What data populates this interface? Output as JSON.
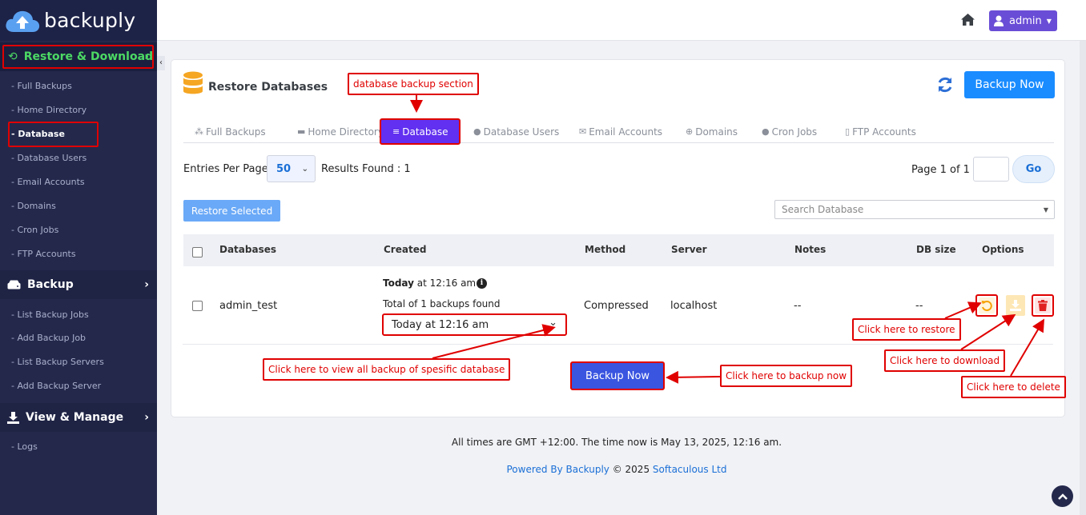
{
  "brand": {
    "name": "backuply"
  },
  "sidebar": {
    "sections": [
      {
        "label": "Restore & Download",
        "items": [
          "- Full Backups",
          "- Home Directory",
          "- Database",
          "- Database Users",
          "- Email Accounts",
          "- Domains",
          "- Cron Jobs",
          "- FTP Accounts"
        ]
      },
      {
        "label": "Backup",
        "items": [
          "- List Backup Jobs",
          "- Add Backup Job",
          "- List Backup Servers",
          "- Add Backup Server"
        ]
      },
      {
        "label": "View & Manage",
        "items": [
          "- Logs"
        ]
      }
    ],
    "current_item": "- Database",
    "collapse_glyph": "‹"
  },
  "topbar": {
    "user": "admin"
  },
  "card": {
    "title": "Restore Databases",
    "backup_now": "Backup Now",
    "tabs": [
      "Full Backups",
      "Home Directory",
      "Database",
      "Database Users",
      "Email Accounts",
      "Domains",
      "Cron Jobs",
      "FTP Accounts"
    ],
    "active_tab": "Database",
    "entries_label": "Entries Per Page",
    "entries_value": "50",
    "results": "Results Found : 1",
    "page_info": "Page 1 of 1",
    "go": "Go",
    "restore_selected": "Restore Selected",
    "search_placeholder": "Search Database"
  },
  "table": {
    "headers": [
      "Databases",
      "Created",
      "Method",
      "Server",
      "Notes",
      "DB size",
      "Options"
    ],
    "row": {
      "database": "admin_test",
      "created_day": "Today",
      "created_time": " at 12:16 am",
      "total": "Total of 1 backups found",
      "selected_backup": "Today at 12:16 am",
      "method": "Compressed",
      "server": "localhost",
      "notes": "--",
      "size": "--"
    },
    "backup_now": "Backup Now"
  },
  "callouts": {
    "section": "database backup section",
    "view_all": "Click here to view all backup of spesific database",
    "backup_now": "Click here to backup now",
    "restore": "Click here to restore",
    "download": "Click here to download",
    "delete": "Click here to delete"
  },
  "footer": {
    "time": "All times are GMT +12:00. The time now is May 13, 2025, 12:16 am.",
    "powered_prefix": "Powered By Backuply",
    "copyright": " © 2025 ",
    "company": "Softaculous Ltd"
  },
  "colors": {
    "sidebar": "#24294c",
    "accent": "#1a8cff",
    "active_tab": "#6130f0",
    "highlight": "#e00000",
    "active_section": "#4cd964"
  }
}
